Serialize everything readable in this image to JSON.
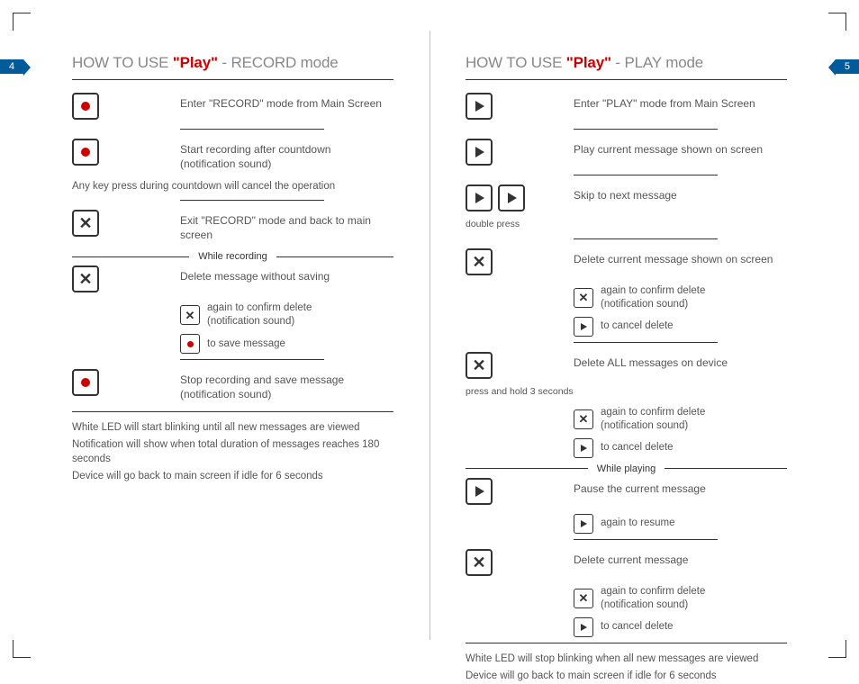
{
  "pageNumbers": {
    "left": "4",
    "right": "5"
  },
  "left": {
    "title_pre": "HOW TO USE ",
    "title_prod": "\"Play\"",
    "title_post": " - RECORD mode",
    "r1": "Enter \"RECORD\" mode from Main Screen",
    "r2a": "Start recording after countdown",
    "r2b": "(notification sound)",
    "note1": "Any key press during countdown will cancel the operation",
    "r3a": "Exit \"RECORD\" mode and back to main",
    "r3b": "screen",
    "sep": "While recording",
    "r4": "Delete message without saving",
    "r4s1a": "again to confirm delete",
    "r4s1b": "(notification sound)",
    "r4s2": "to save message",
    "r5a": "Stop recording and save message",
    "r5b": "(notification sound)",
    "foot1": "White LED will start blinking until all new messages are viewed",
    "foot2": "Notification will show when total duration of messages reaches 180 seconds",
    "foot3": "Device will go back to main screen if idle for 6 seconds"
  },
  "right": {
    "title_pre": "HOW TO USE ",
    "title_prod": "\"Play\"",
    "title_post": " - PLAY mode",
    "r1": "Enter \"PLAY\" mode from Main Screen",
    "r2": "Play current message shown on screen",
    "r3": "Skip to next message",
    "r3_lbl": "double press",
    "r4": "Delete current message shown on screen",
    "r4s1a": "again to confirm delete",
    "r4s1b": "(notification sound)",
    "r4s2": "to cancel delete",
    "r5": "Delete ALL messages on device",
    "r5_lbl": "press and hold 3 seconds",
    "r5s1a": "again to confirm delete",
    "r5s1b": "(notification sound)",
    "r5s2": "to cancel delete",
    "sep": "While playing",
    "r6": "Pause the current message",
    "r6s1": "again to resume",
    "r7": "Delete current message",
    "r7s1a": "again to confirm delete",
    "r7s1b": "(notification sound)",
    "r7s2": "to cancel delete",
    "foot1": "White LED will stop blinking when all new messages are viewed",
    "foot2": "Device will go back to main screen if idle for 6 seconds"
  }
}
